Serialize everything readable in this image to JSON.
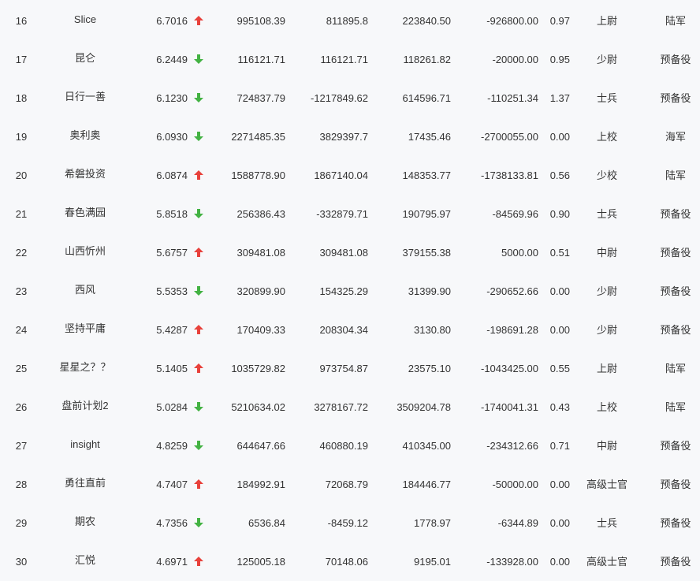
{
  "colors": {
    "up": "#e8413b",
    "down": "#43b243",
    "text": "#333333",
    "background": "#f7f8fa"
  },
  "rows": [
    {
      "rank": "16",
      "name": "Slice",
      "score": "6.7016",
      "trend": "up",
      "v1": "995108.39",
      "v2": "811895.8",
      "v3": "223840.50",
      "v4": "-926800.00",
      "ratio": "0.97",
      "level": "上尉",
      "branch": "陆军"
    },
    {
      "rank": "17",
      "name": "昆仑",
      "score": "6.2449",
      "trend": "down",
      "v1": "116121.71",
      "v2": "116121.71",
      "v3": "118261.82",
      "v4": "-20000.00",
      "ratio": "0.95",
      "level": "少尉",
      "branch": "预备役"
    },
    {
      "rank": "18",
      "name": "日行一善",
      "score": "6.1230",
      "trend": "down",
      "v1": "724837.79",
      "v2": "-1217849.62",
      "v3": "614596.71",
      "v4": "-110251.34",
      "ratio": "1.37",
      "level": "士兵",
      "branch": "预备役"
    },
    {
      "rank": "19",
      "name": "奥利奥",
      "score": "6.0930",
      "trend": "down",
      "v1": "2271485.35",
      "v2": "3829397.7",
      "v3": "17435.46",
      "v4": "-2700055.00",
      "ratio": "0.00",
      "level": "上校",
      "branch": "海军"
    },
    {
      "rank": "20",
      "name": "希磐投资",
      "score": "6.0874",
      "trend": "up",
      "v1": "1588778.90",
      "v2": "1867140.04",
      "v3": "148353.77",
      "v4": "-1738133.81",
      "ratio": "0.56",
      "level": "少校",
      "branch": "陆军"
    },
    {
      "rank": "21",
      "name": "春色满园",
      "score": "5.8518",
      "trend": "down",
      "v1": "256386.43",
      "v2": "-332879.71",
      "v3": "190795.97",
      "v4": "-84569.96",
      "ratio": "0.90",
      "level": "士兵",
      "branch": "预备役"
    },
    {
      "rank": "22",
      "name": "山西忻州",
      "score": "5.6757",
      "trend": "up",
      "v1": "309481.08",
      "v2": "309481.08",
      "v3": "379155.38",
      "v4": "5000.00",
      "ratio": "0.51",
      "level": "中尉",
      "branch": "预备役"
    },
    {
      "rank": "23",
      "name": "西风",
      "score": "5.5353",
      "trend": "down",
      "v1": "320899.90",
      "v2": "154325.29",
      "v3": "31399.90",
      "v4": "-290652.66",
      "ratio": "0.00",
      "level": "少尉",
      "branch": "预备役"
    },
    {
      "rank": "24",
      "name": "坚持平庸",
      "score": "5.4287",
      "trend": "up",
      "v1": "170409.33",
      "v2": "208304.34",
      "v3": "3130.80",
      "v4": "-198691.28",
      "ratio": "0.00",
      "level": "少尉",
      "branch": "预备役"
    },
    {
      "rank": "25",
      "name": "星星之？？",
      "score": "5.1405",
      "trend": "up",
      "v1": "1035729.82",
      "v2": "973754.87",
      "v3": "23575.10",
      "v4": "-1043425.00",
      "ratio": "0.55",
      "level": "上尉",
      "branch": "陆军"
    },
    {
      "rank": "26",
      "name": "盘前计划2",
      "score": "5.0284",
      "trend": "down",
      "v1": "5210634.02",
      "v2": "3278167.72",
      "v3": "3509204.78",
      "v4": "-1740041.31",
      "ratio": "0.43",
      "level": "上校",
      "branch": "陆军"
    },
    {
      "rank": "27",
      "name": "insight",
      "score": "4.8259",
      "trend": "down",
      "v1": "644647.66",
      "v2": "460880.19",
      "v3": "410345.00",
      "v4": "-234312.66",
      "ratio": "0.71",
      "level": "中尉",
      "branch": "预备役"
    },
    {
      "rank": "28",
      "name": "勇往直前",
      "score": "4.7407",
      "trend": "up",
      "v1": "184992.91",
      "v2": "72068.79",
      "v3": "184446.77",
      "v4": "-50000.00",
      "ratio": "0.00",
      "level": "高级士官",
      "branch": "预备役"
    },
    {
      "rank": "29",
      "name": "期农",
      "score": "4.7356",
      "trend": "down",
      "v1": "6536.84",
      "v2": "-8459.12",
      "v3": "1778.97",
      "v4": "-6344.89",
      "ratio": "0.00",
      "level": "士兵",
      "branch": "预备役"
    },
    {
      "rank": "30",
      "name": "汇悦",
      "score": "4.6971",
      "trend": "up",
      "v1": "125005.18",
      "v2": "70148.06",
      "v3": "9195.01",
      "v4": "-133928.00",
      "ratio": "0.00",
      "level": "高级士官",
      "branch": "预备役"
    }
  ]
}
